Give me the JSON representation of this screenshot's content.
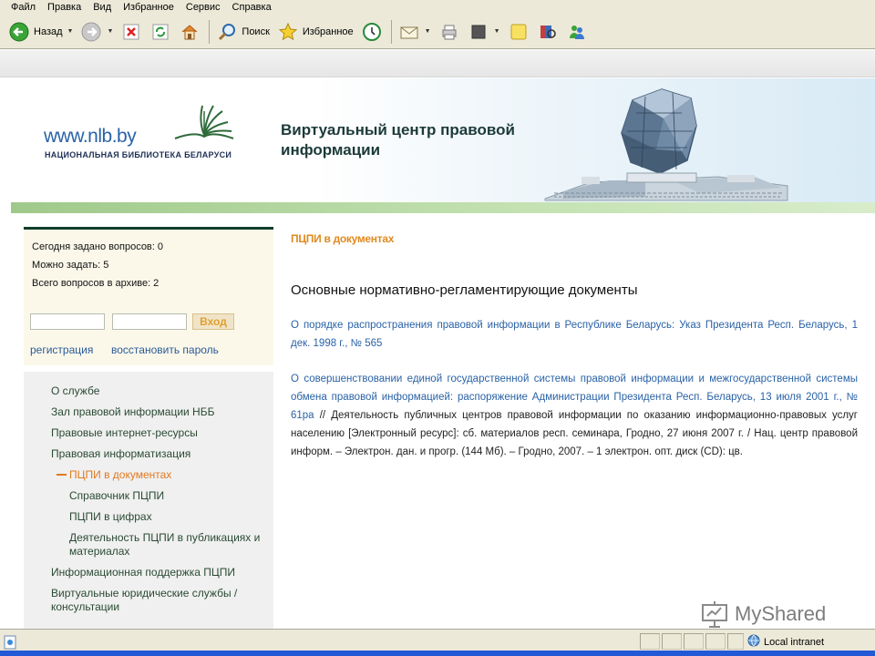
{
  "menu": [
    "Файл",
    "Правка",
    "Вид",
    "Избранное",
    "Сервис",
    "Справка"
  ],
  "toolbar": {
    "back_label": "Назад",
    "search_label": "Поиск",
    "favorites_label": "Избранное"
  },
  "site": {
    "logo_url": "www.nlb.by",
    "logo_subtitle": "НАЦИОНАЛЬНАЯ БИБЛИОТЕКА БЕЛАРУСИ",
    "title_line1": "Виртуальный центр правовой",
    "title_line2": "информации"
  },
  "stats": {
    "today": "Сегодня задано вопросов: 0",
    "can_ask": "Можно задать: 5",
    "archive": "Всего вопросов в архиве: 2"
  },
  "login": {
    "button": "Вход",
    "register": "регистрация",
    "restore": "восстановить пароль"
  },
  "nav": [
    "О службе",
    "Зал правовой информации НББ",
    "Правовые интернет-ресурсы",
    "Правовая информатизация",
    "ПЦПИ в документах",
    "Справочник ПЦПИ",
    "ПЦПИ в цифрах",
    "Деятельность ПЦПИ в публикациях и материалах",
    "Информационная поддержка ПЦПИ",
    "Виртуальные юридические службы / консультации"
  ],
  "content": {
    "breadcrumb": "ПЦПИ в документах",
    "heading": "Основные нормативно-регламентирующие документы",
    "doc1_link": "О порядке распространения правовой информации в Республике Беларусь: Указ Президента Респ. Беларусь, 1 дек. 1998 г., № 565",
    "doc2_link": "О совершенствовании единой государственной системы правовой информации и межгосударственной системы обмена правовой информацией: распоряжение Администрации Президента Респ. Беларусь, 13 июля 2001 г., № 61ра",
    "doc2_text": " // Деятельность публичных центров правовой информации по оказанию информационно-правовых услуг населению [Электронный ресурс]: сб. материалов респ. семинара, Гродно, 27 июня 2007 г. / Нац. центр правовой информ. – Электрон. дан. и прогр. (144 Мб). – Гродно, 2007. – 1 электрон. опт. диск (CD): цв."
  },
  "status": {
    "zone": "Local intranet"
  },
  "watermark": "MyShared",
  "icons": [
    "back-arrow-icon",
    "forward-arrow-icon",
    "stop-icon",
    "refresh-icon",
    "home-icon",
    "search-icon",
    "favorites-star-icon",
    "history-icon",
    "mail-icon",
    "print-icon",
    "edit-icon",
    "notes-icon",
    "research-icon",
    "messenger-icon",
    "globe-icon"
  ],
  "colors": {
    "link": "#2a62a6",
    "accent_orange": "#e07a20",
    "green_bar": "#9fc98a",
    "dark_green": "#0f3d2a"
  }
}
